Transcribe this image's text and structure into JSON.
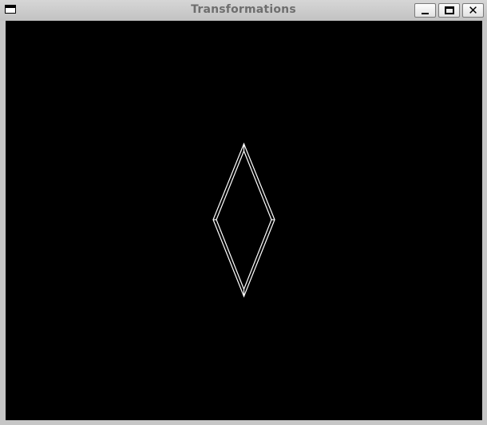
{
  "window": {
    "title": "Transformations",
    "controls": {
      "minimize_icon": "minimize-icon",
      "maximize_icon": "maximize-icon",
      "close_icon": "close-icon",
      "close_glyph": "✕"
    }
  },
  "canvas": {
    "background": "#000000",
    "stroke_color": "#ffffff",
    "shape": "diamond-outline"
  }
}
